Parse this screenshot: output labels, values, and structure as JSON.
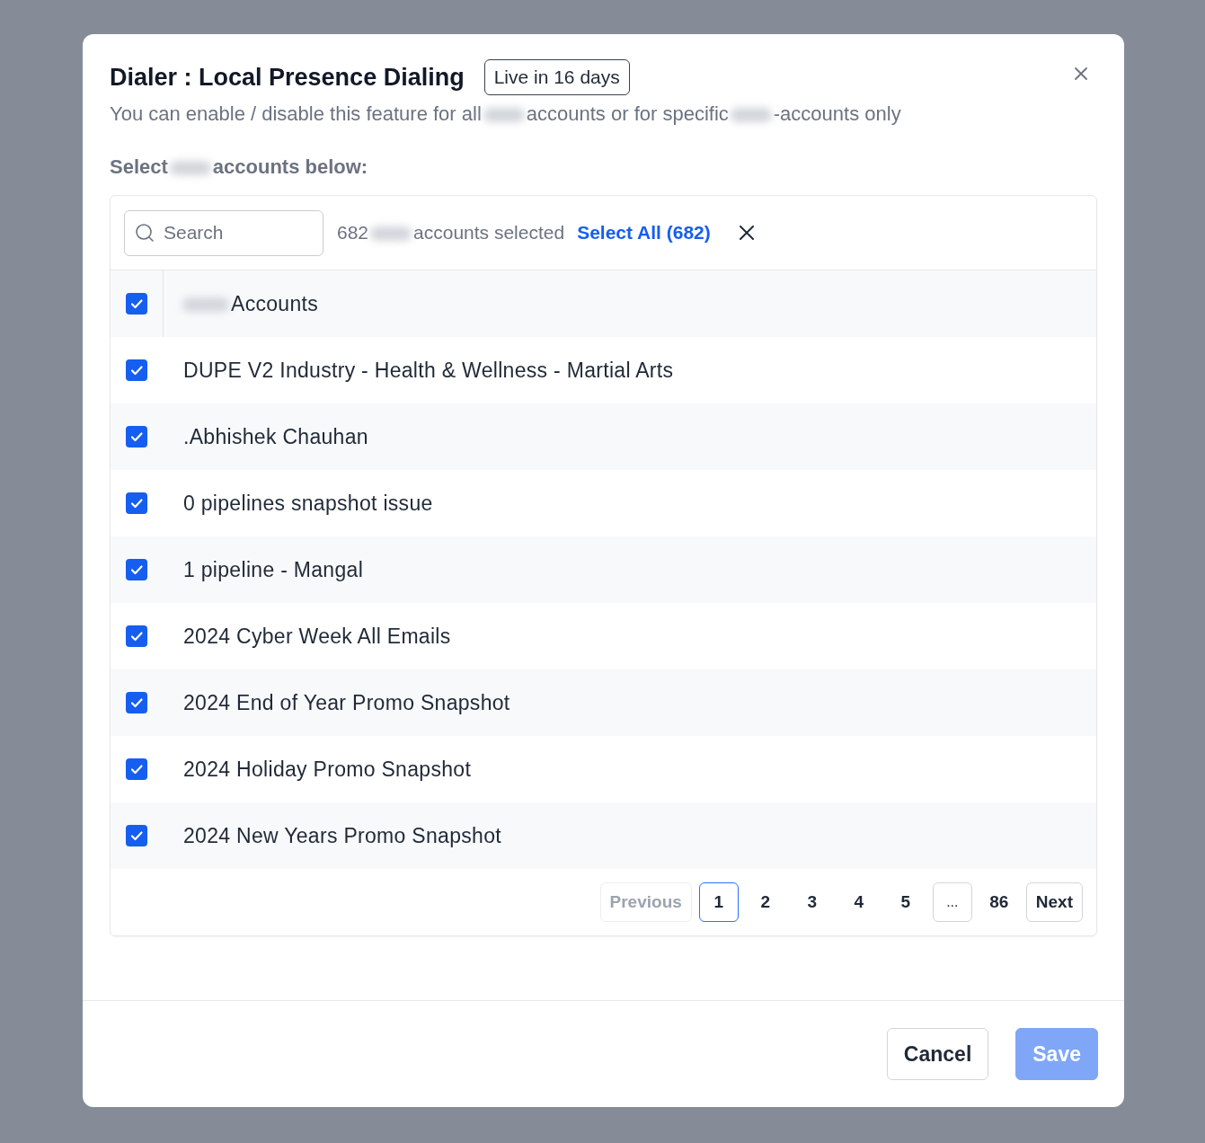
{
  "dialog": {
    "title": "Dialer : Local Presence Dialing",
    "badge": "Live in 16 days",
    "subtitle": [
      "You can enable / disable this feature for all",
      "accounts or for specific",
      "-accounts only"
    ],
    "section_label": [
      "Select",
      "accounts below:"
    ]
  },
  "toolbar": {
    "search": {
      "placeholder": "Search"
    },
    "selected_count": [
      "682",
      "accounts selected"
    ],
    "select_all": "Select All (682)"
  },
  "table": {
    "header": {
      "label": "Accounts",
      "checked": true
    },
    "rows": [
      {
        "name": "DUPE V2 Industry - Health & Wellness - Martial Arts",
        "checked": true
      },
      {
        "name": ".Abhishek Chauhan",
        "checked": true
      },
      {
        "name": "0 pipelines snapshot issue",
        "checked": true
      },
      {
        "name": "1 pipeline - Mangal",
        "checked": true
      },
      {
        "name": "2024 Cyber Week All Emails",
        "checked": true
      },
      {
        "name": "2024 End of Year Promo Snapshot",
        "checked": true
      },
      {
        "name": "2024 Holiday Promo Snapshot",
        "checked": true
      },
      {
        "name": "2024 New Years Promo Snapshot",
        "checked": true
      }
    ]
  },
  "pagination": {
    "previous": {
      "label": "Previous",
      "disabled": true
    },
    "pages": [
      {
        "label": "1",
        "kind": "page",
        "selected": true
      },
      {
        "label": "2",
        "kind": "page",
        "selected": false
      },
      {
        "label": "3",
        "kind": "page",
        "selected": false
      },
      {
        "label": "4",
        "kind": "page",
        "selected": false
      },
      {
        "label": "5",
        "kind": "page",
        "selected": false
      },
      {
        "label": "...",
        "kind": "ellipsis",
        "selected": false
      },
      {
        "label": "86",
        "kind": "page",
        "selected": false
      }
    ],
    "next": {
      "label": "Next",
      "disabled": false
    }
  },
  "footer": {
    "cancel": {
      "label": "Cancel",
      "disabled": false
    },
    "save": {
      "label": "Save",
      "disabled": true
    }
  }
}
